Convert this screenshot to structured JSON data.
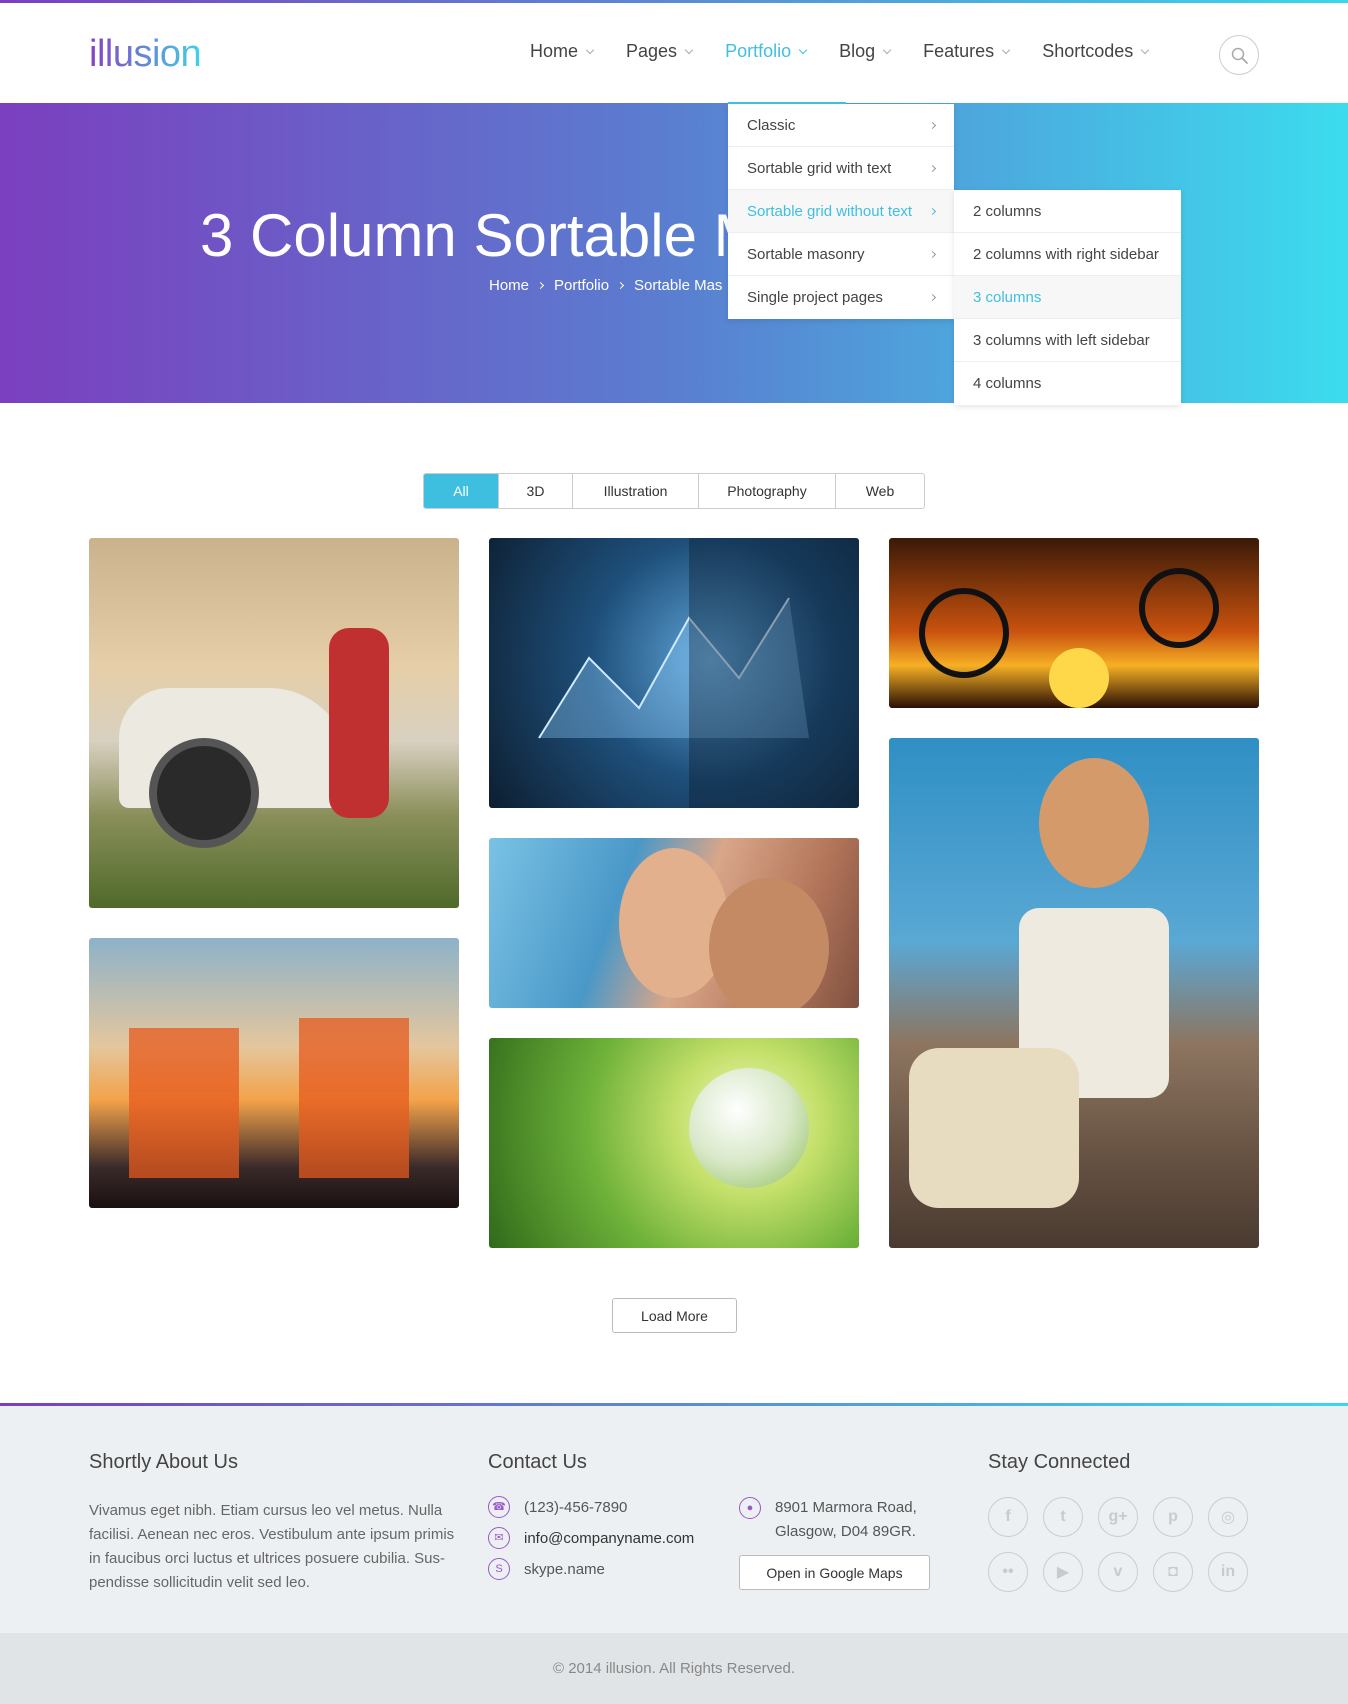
{
  "brand": {
    "logo_text": "illusion",
    "gradient_start": "#7b3fbf",
    "gradient_end": "#3ad7ec",
    "accent": "#3fbfe0"
  },
  "nav": {
    "items": [
      {
        "label": "Home",
        "active": false
      },
      {
        "label": "Pages",
        "active": false
      },
      {
        "label": "Portfolio",
        "active": true
      },
      {
        "label": "Blog",
        "active": false
      },
      {
        "label": "Features",
        "active": false
      },
      {
        "label": "Shortcodes",
        "active": false
      }
    ],
    "search_icon": "search-icon"
  },
  "hero": {
    "title": "3 Column Sortable M",
    "breadcrumb": [
      "Home",
      "Portfolio",
      "Sortable Mas"
    ]
  },
  "portfolio_menu": {
    "items": [
      {
        "label": "Classic",
        "active": false
      },
      {
        "label": "Sortable grid with text",
        "active": false
      },
      {
        "label": "Sortable grid without text",
        "active": true
      },
      {
        "label": "Sortable masonry",
        "active": false
      },
      {
        "label": "Single project pages",
        "active": false
      }
    ],
    "submenu": [
      {
        "label": "2 columns",
        "active": false
      },
      {
        "label": "2 columns with right sidebar",
        "active": false
      },
      {
        "label": "3 columns",
        "active": true
      },
      {
        "label": "3 columns with left sidebar",
        "active": false
      },
      {
        "label": "4 columns",
        "active": false
      }
    ]
  },
  "filters": [
    {
      "label": "All",
      "active": true
    },
    {
      "label": "3D",
      "active": false
    },
    {
      "label": "Illustration",
      "active": false
    },
    {
      "label": "Photography",
      "active": false
    },
    {
      "label": "Web",
      "active": false
    }
  ],
  "gallery": [
    {
      "name": "woman-with-binoculars-car"
    },
    {
      "name": "business-chart-touchscreen"
    },
    {
      "name": "cyclists-sunset-silhouette"
    },
    {
      "name": "smiling-couple"
    },
    {
      "name": "woman-with-sunglasses-bag"
    },
    {
      "name": "couple-beach-chairs-sunset"
    },
    {
      "name": "glass-globe-grass"
    }
  ],
  "load_more_label": "Load More",
  "footer": {
    "about": {
      "title": "Shortly About Us",
      "text": "Vivamus eget nibh. Etiam cursus leo vel metus. Nulla facilisi. Aenean nec eros. Vestibulum ante ipsum primis in faucibus orci luctus et ultrices posuere cubilia. Sus- pendisse sollicitudin velit sed leo."
    },
    "contact": {
      "title": "Contact Us",
      "phone": "(123)-456-7890",
      "email": "info@companyname.com",
      "skype": "skype.name",
      "address_line1": "8901 Marmora Road,",
      "address_line2": "Glasgow, D04 89GR.",
      "maps_button": "Open in Google Maps"
    },
    "social": {
      "title": "Stay Connected",
      "icons": [
        "facebook-icon",
        "twitter-icon",
        "google-plus-icon",
        "pinterest-icon",
        "dribbble-icon",
        "flickr-icon",
        "youtube-icon",
        "vimeo-icon",
        "instagram-icon",
        "linkedin-icon"
      ]
    }
  },
  "copyright": "© 2014 illusion. All Rights Reserved."
}
